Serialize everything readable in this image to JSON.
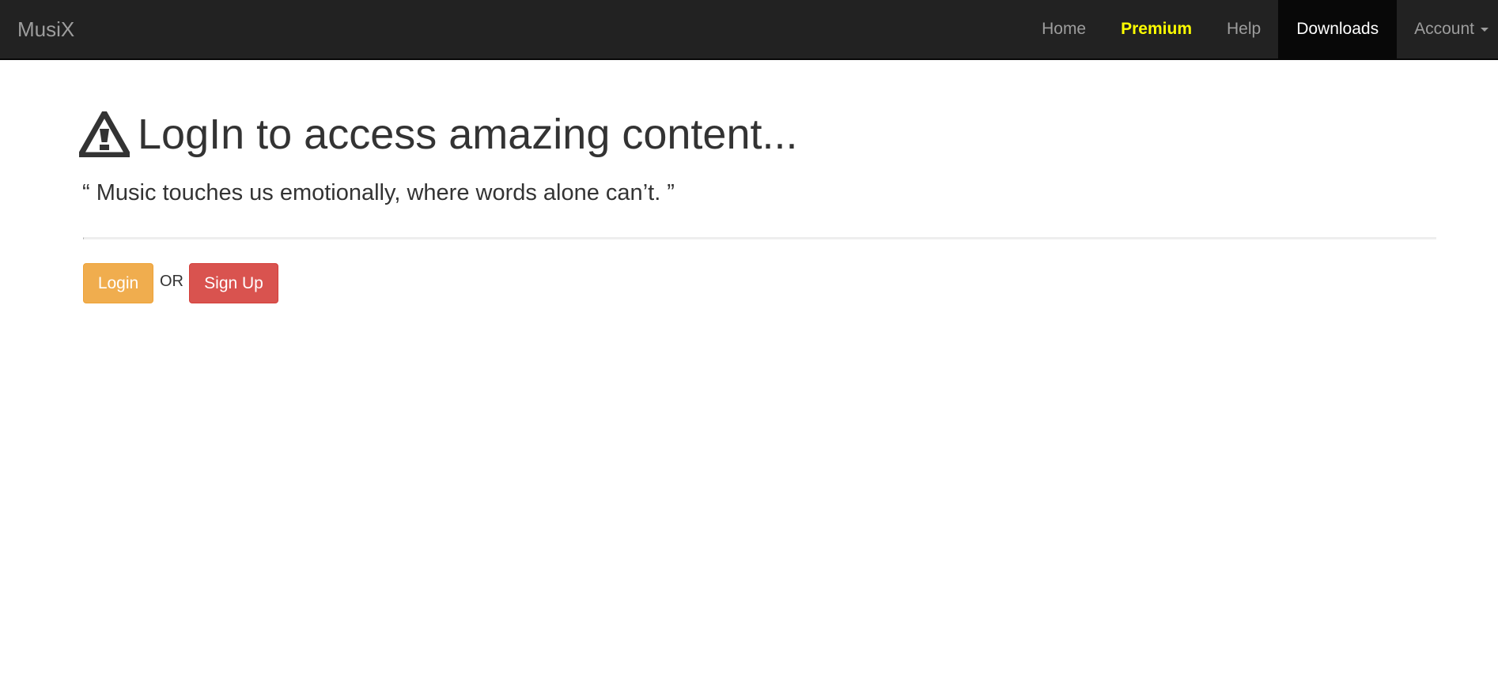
{
  "navbar": {
    "brand": "MusiX",
    "items": [
      {
        "label": "Home"
      },
      {
        "label": "Premium",
        "color": "#ffff00"
      },
      {
        "label": "Help"
      },
      {
        "label": "Downloads",
        "active": true
      },
      {
        "label": "Account",
        "dropdown": true
      }
    ]
  },
  "main": {
    "headline_icon": "warning-sign-icon",
    "headline": "LogIn to access amazing content...",
    "quote": "“ Music touches us emotionally, where words alone can’t. ”",
    "login_label": "Login",
    "or_label": "OR",
    "signup_label": "Sign Up"
  },
  "colors": {
    "navbar_bg": "#222222",
    "nav_link": "#9d9d9d",
    "premium": "#ffff00",
    "active_bg": "#080808",
    "login_btn": "#f0ad4e",
    "signup_btn": "#d9534f"
  }
}
